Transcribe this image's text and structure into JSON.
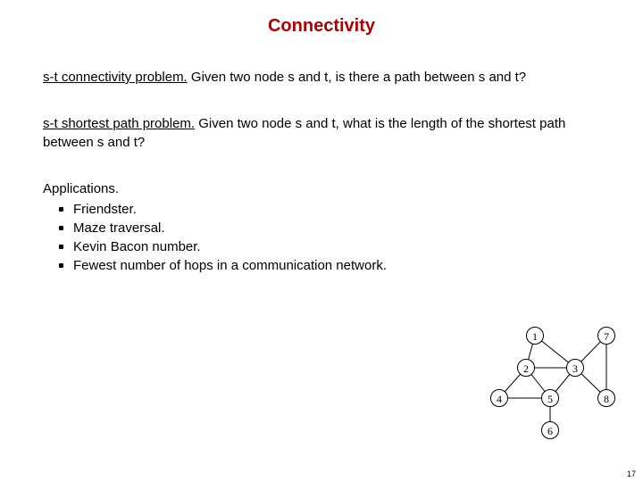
{
  "title": "Connectivity",
  "p1": {
    "term": "s-t connectivity problem.",
    "rest": "  Given two node s and t, is there a path between s and t?"
  },
  "p2": {
    "term": "s-t shortest path problem.",
    "rest": "  Given two node s and t, what is the length of the shortest path between s and t?"
  },
  "apps": {
    "heading": "Applications.",
    "items": [
      "Friendster.",
      "Maze traversal.",
      "Kevin Bacon number.",
      "Fewest number of hops in a communication network."
    ]
  },
  "graph": {
    "nodes": [
      "1",
      "2",
      "3",
      "4",
      "5",
      "6",
      "7",
      "8"
    ]
  },
  "pagenum": "17"
}
